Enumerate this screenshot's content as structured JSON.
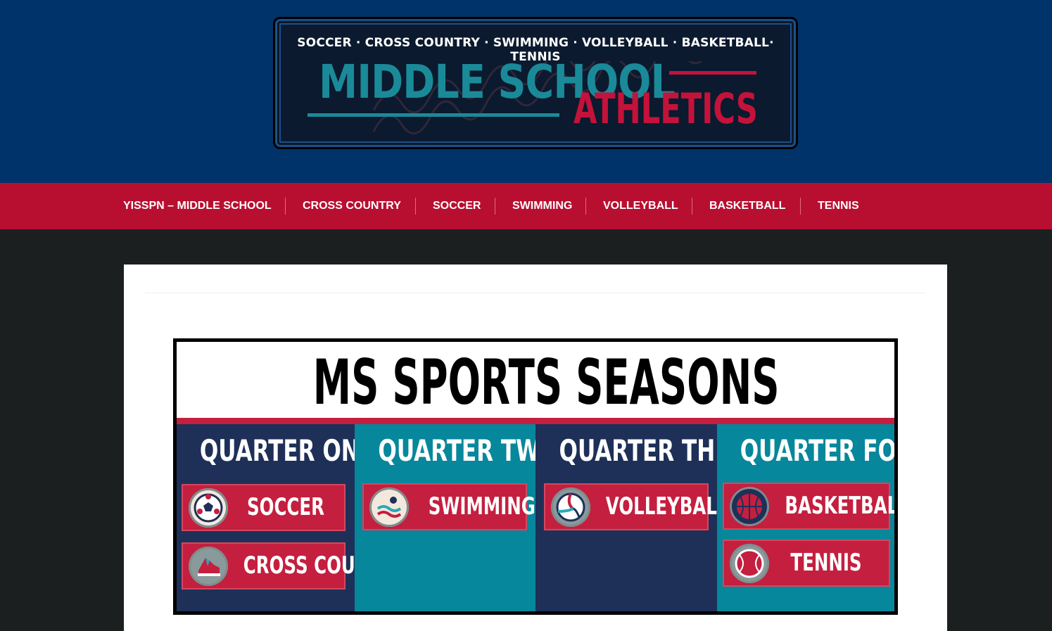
{
  "header": {
    "logo": {
      "sports_line": "SOCCER · CROSS COUNTRY · SWIMMING · VOLLEYBALL · BASKETBALL· TENNIS",
      "title_main": "MIDDLE SCHOOL",
      "title_sub": "ATHLETICS"
    }
  },
  "nav": {
    "items": [
      {
        "label": "YISSPN – MIDDLE SCHOOL"
      },
      {
        "label": "CROSS COUNTRY"
      },
      {
        "label": "SOCCER"
      },
      {
        "label": "SWIMMING"
      },
      {
        "label": "VOLLEYBALL"
      },
      {
        "label": "BASKETBALL"
      },
      {
        "label": "TENNIS"
      }
    ]
  },
  "graphic": {
    "title": "MS SPORTS SEASONS",
    "quarters": [
      {
        "heading": "QUARTER ONE",
        "color": "#1e3058",
        "sports": [
          {
            "label": "SOCCER",
            "icon": "soccer-ball-icon"
          },
          {
            "label": "CROSS COUNTRY",
            "icon": "running-shoe-icon"
          }
        ]
      },
      {
        "heading": "QUARTER TWO",
        "color": "#06879b",
        "sports": [
          {
            "label": "SWIMMING",
            "icon": "swimmer-icon"
          }
        ]
      },
      {
        "heading": "QUARTER THREE",
        "color": "#1e3058",
        "sports": [
          {
            "label": "VOLLEYBALL",
            "icon": "volleyball-icon"
          }
        ]
      },
      {
        "heading": "QUARTER FOUR",
        "color": "#06879b",
        "sports": [
          {
            "label": "BASKETBALL",
            "icon": "basketball-icon"
          },
          {
            "label": "TENNIS",
            "icon": "tennis-ball-icon"
          }
        ]
      }
    ]
  },
  "colors": {
    "header_bg": "#003369",
    "nav_bg": "#b80f30",
    "page_bg": "#1b1f1f",
    "accent_red": "#c41f3f",
    "accent_teal": "#1a8a99"
  }
}
